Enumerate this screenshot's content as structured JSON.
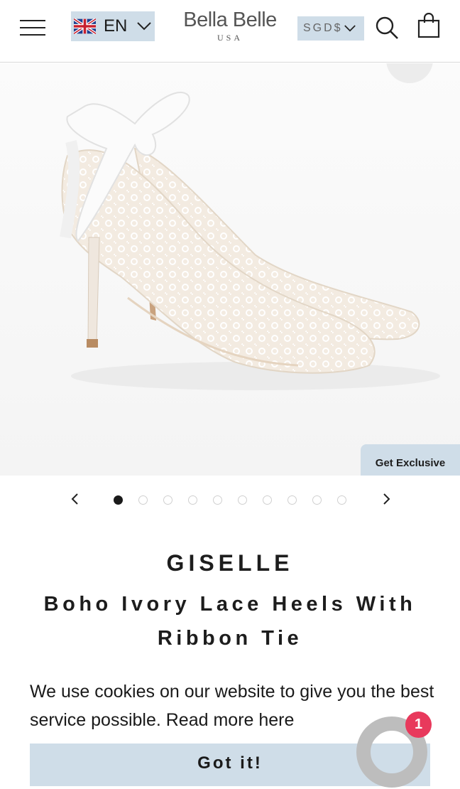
{
  "header": {
    "language_label": "EN",
    "logo_main": "Bella Belle",
    "logo_sub": "USA",
    "currency_label": "SGD$"
  },
  "icons": {
    "menu": "hamburger-menu-icon",
    "flag": "uk-flag-icon",
    "language_dropdown": "chevron-down-icon",
    "currency_dropdown": "chevron-down-icon",
    "search": "search-icon",
    "cart": "shopping-bag-icon",
    "prev": "chevron-left-icon",
    "next": "chevron-right-icon"
  },
  "hero": {
    "image_alt": "Ivory lace pointed-toe heels with satin ribbon tie",
    "deals_label": "Get Exclusive Deals"
  },
  "carousel": {
    "slide_count": 10,
    "active_index": 0
  },
  "product": {
    "name": "GISELLE",
    "subtitle": "Boho Ivory Lace Heels With Ribbon Tie"
  },
  "cookie": {
    "message": "We use cookies on our website to give you the best service possible. Read more here",
    "button_label": "Got it!"
  },
  "chat": {
    "badge_count": "1"
  },
  "colors": {
    "accent_bg": "#cfdde8",
    "text": "#1c1c1c",
    "badge": "#e8395c"
  }
}
